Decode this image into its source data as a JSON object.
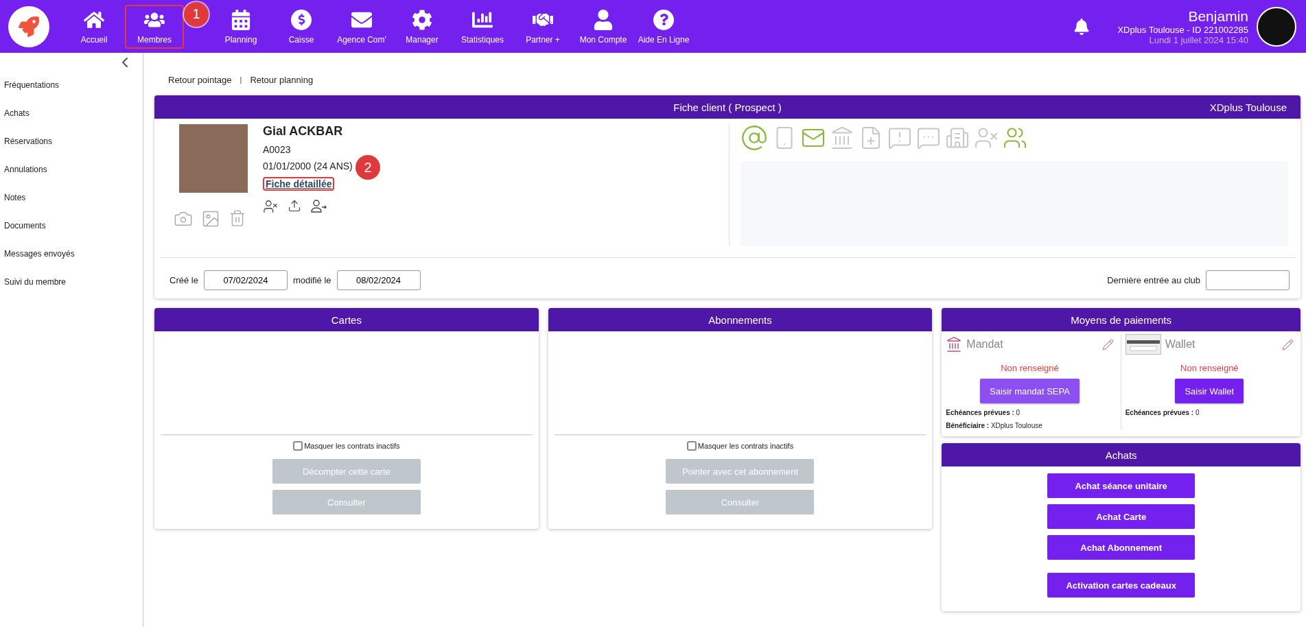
{
  "nav": {
    "items": [
      {
        "label": "Accueil"
      },
      {
        "label": "Membres"
      },
      {
        "label": "Planning"
      },
      {
        "label": "Caisse"
      },
      {
        "label": "Agence Com'"
      },
      {
        "label": "Manager"
      },
      {
        "label": "Statistiques"
      },
      {
        "label": "Partner +"
      },
      {
        "label": "Mon Compte"
      },
      {
        "label": "Aide En Ligne"
      }
    ]
  },
  "user": {
    "name": "Benjamin",
    "club": "XDplus Toulouse - ID 221002285",
    "date": "Lundi 1 juillet 2024 15:40"
  },
  "sidebar": {
    "items": [
      {
        "label": "Fréquentations"
      },
      {
        "label": "Achats"
      },
      {
        "label": "Réservations"
      },
      {
        "label": "Annulations"
      },
      {
        "label": "Notes"
      },
      {
        "label": "Documents"
      },
      {
        "label": "Messages envoyés"
      },
      {
        "label": "Suivi du membre"
      }
    ]
  },
  "breadcrumb_links": [
    {
      "label": "Retour pointage"
    },
    {
      "label": "Retour planning"
    }
  ],
  "breadcrumb_separator": "|",
  "client_card": {
    "title": "Fiche client ( Prospect )",
    "club": "XDplus Toulouse",
    "name": "Gial ACKBAR",
    "code": "A0023",
    "birth": "01/01/2000 (24 ANS)",
    "detail_link": "Fiche détaillée",
    "contact_icons": [
      {
        "active": true
      },
      {
        "active": false
      },
      {
        "active": true
      },
      {
        "active": false
      },
      {
        "active": false
      },
      {
        "active": false
      },
      {
        "active": false
      },
      {
        "active": false
      },
      {
        "active": false
      },
      {
        "active": true
      }
    ],
    "created_label": "Créé le",
    "created": "07/02/2024",
    "modified_label": "modifié le",
    "modified": "08/02/2024",
    "last_entry_label": "Dernière entrée au club"
  },
  "panels": [
    {
      "title": "Cartes",
      "checkbox": {
        "label": "Masquer les contrats inactifs",
        "checked": false
      },
      "buttons": [
        {
          "label": "Décompter cette carte",
          "disabled": true
        },
        {
          "label": "Consulter",
          "disabled": true
        }
      ]
    },
    {
      "title": "Abonnements",
      "checkbox": {
        "label": "Masquer les contrats inactifs",
        "checked": false
      },
      "buttons": [
        {
          "label": "Pointer avec cet abonnement",
          "disabled": true
        },
        {
          "label": "Consulter",
          "disabled": true
        }
      ]
    }
  ],
  "payments": {
    "title": "Moyens de paiements",
    "methods": [
      {
        "kind": "mandate",
        "name": "Mandat",
        "status": "Non renseigné",
        "button": "Saisir mandat SEPA",
        "details": [
          {
            "label": "Echéances prévues :",
            "value": "0"
          },
          {
            "label": "Bénéficiaire :",
            "value": "XDplus Toulouse"
          }
        ]
      },
      {
        "kind": "wallet",
        "name": "Wallet",
        "status": "Non renseigné",
        "button": "Saisir Wallet",
        "details": [
          {
            "label": "Echéances prévues :",
            "value": "0"
          }
        ]
      }
    ]
  },
  "purchases": {
    "title": "Achats",
    "buttons": [
      {
        "label": "Achat séance unitaire"
      },
      {
        "label": "Achat Carte"
      },
      {
        "label": "Achat Abonnement"
      },
      {
        "label": "Activation cartes cadeaux"
      }
    ]
  },
  "annotations": [
    {
      "label": "1"
    },
    {
      "label": "2"
    }
  ]
}
